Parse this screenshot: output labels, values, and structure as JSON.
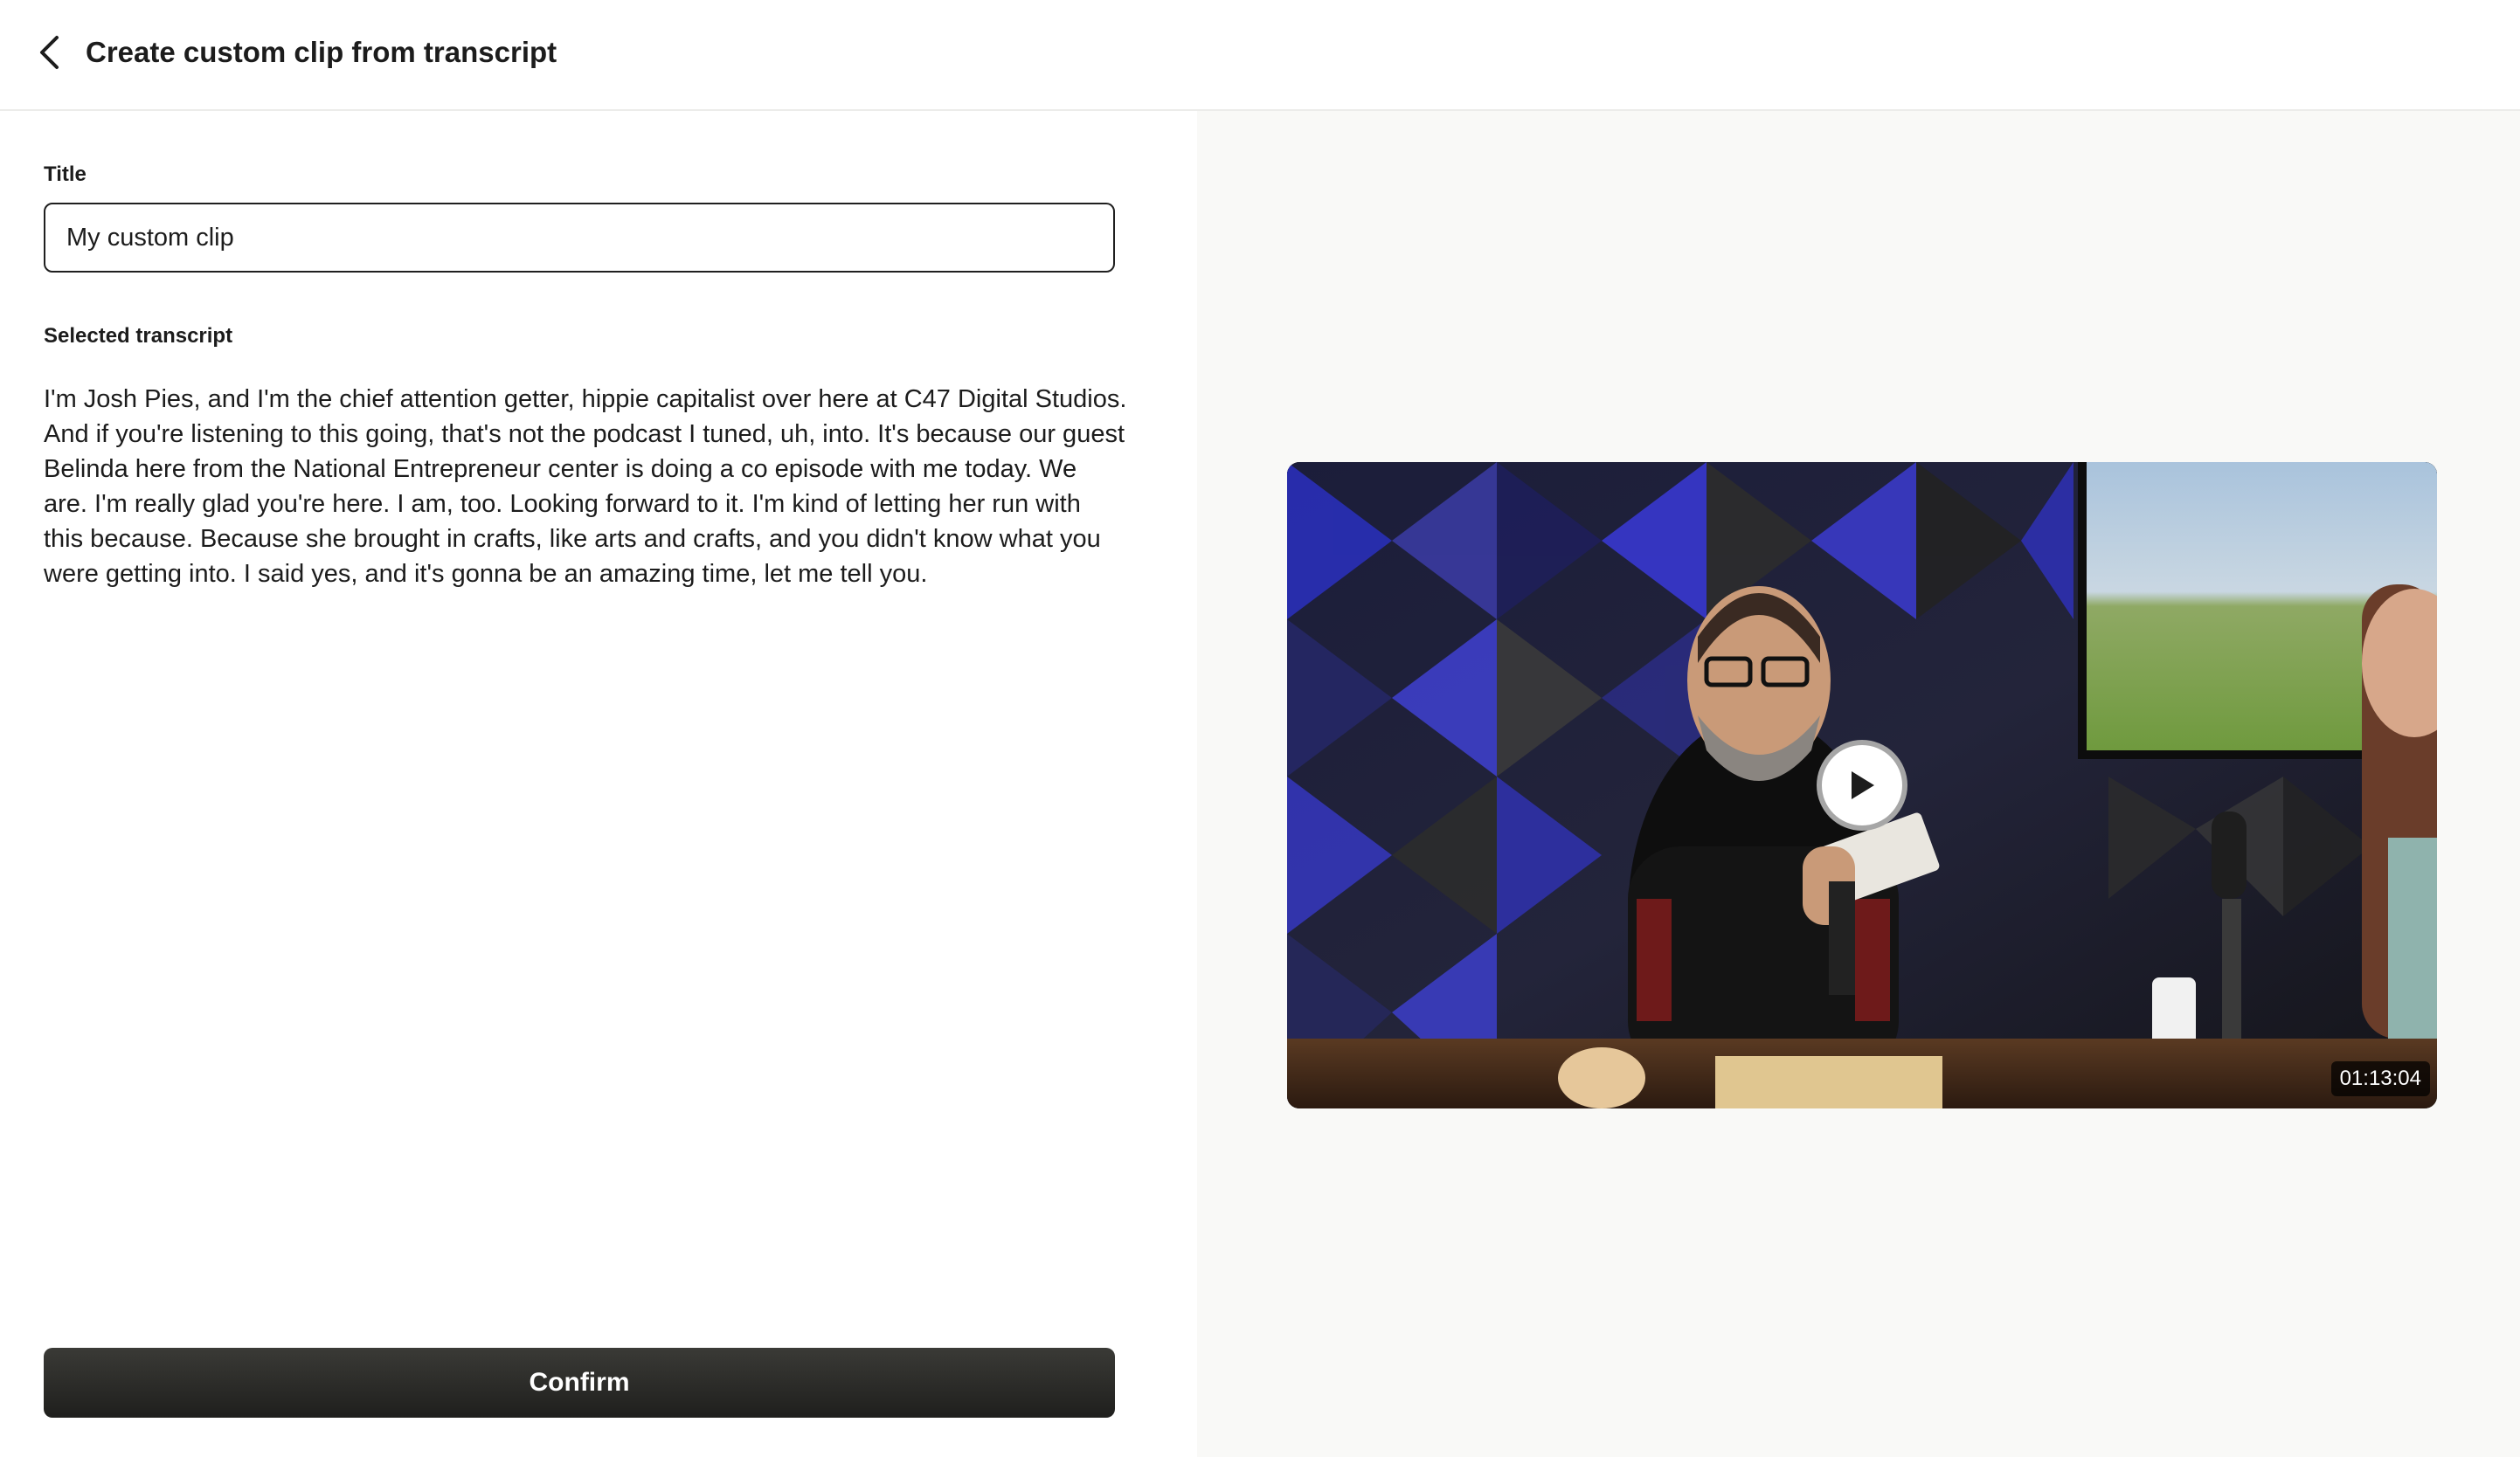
{
  "header": {
    "title": "Create custom clip from transcript",
    "back_icon": "chevron-left-icon"
  },
  "form": {
    "title_label": "Title",
    "title_value": "My custom clip",
    "transcript_label": "Selected transcript",
    "transcript_text": "I'm Josh Pies, and I'm the chief attention getter, hippie capitalist over here at C47 Digital Studios. And if you're listening to this going, that's not the podcast I tuned, uh, into. It's because our guest Belinda here from the National Entrepreneur center is doing a co episode with me today. We are. I'm really glad you're here. I am, too. Looking forward to it. I'm kind of letting her run with this because. Because she brought in crafts, like arts and crafts, and you didn't know what you were getting into. I said yes, and it's gonna be an amazing time, let me tell you.",
    "confirm_label": "Confirm"
  },
  "video": {
    "duration": "01:13:04",
    "play_icon": "play-icon"
  },
  "colors": {
    "button_bg": "#2a2a27",
    "right_panel_bg": "#f9f9f7",
    "text": "#1c1c1c"
  }
}
